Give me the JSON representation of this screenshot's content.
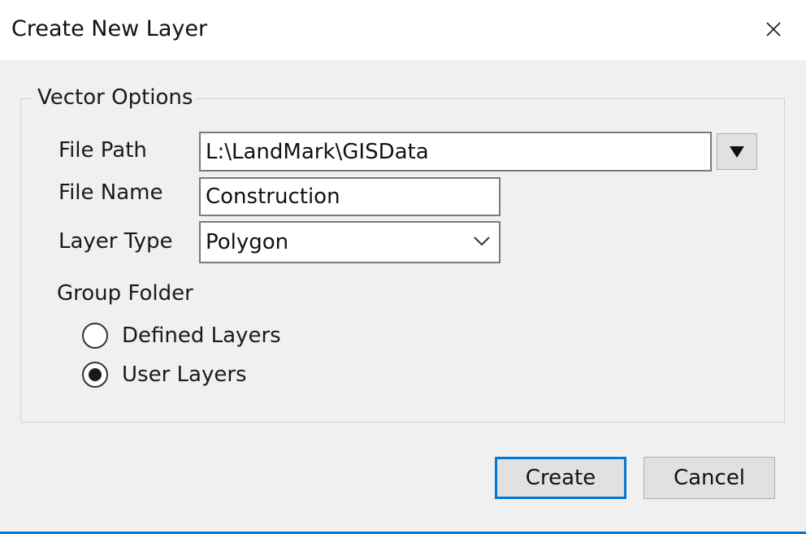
{
  "window": {
    "title": "Create New Layer",
    "close_icon": "close-icon"
  },
  "vector_options": {
    "legend": "Vector Options",
    "file_path": {
      "label": "File Path",
      "value": "L:\\LandMark\\GISData",
      "browse_icon": "triangle-down-icon"
    },
    "file_name": {
      "label": "File Name",
      "value": "Construction"
    },
    "layer_type": {
      "label": "Layer Type",
      "selected": "Polygon",
      "dropdown_icon": "chevron-down-icon"
    },
    "group_folder": {
      "label": "Group Folder",
      "options": [
        {
          "label": "Defined Layers",
          "checked": false
        },
        {
          "label": "User Layers",
          "checked": true
        }
      ]
    }
  },
  "buttons": {
    "create": "Create",
    "cancel": "Cancel"
  },
  "colors": {
    "accent": "#0078d7",
    "background": "#f0f0f0"
  }
}
